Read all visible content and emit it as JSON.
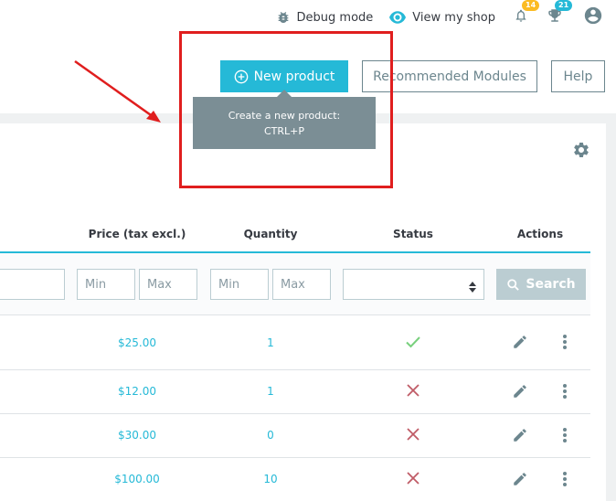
{
  "topbar": {
    "debug_label": "Debug mode",
    "view_shop_label": "View my shop",
    "orders_badge": "14",
    "customers_badge": "21",
    "orders_badge_color": "#fbbb22",
    "customers_badge_color": "#25b9d7"
  },
  "header": {
    "new_product_label": "New product",
    "recommended_label": "Recommended Modules",
    "help_label": "Help",
    "tooltip_line1": "Create a new product:",
    "tooltip_line2": "CTRL+P"
  },
  "table": {
    "columns": [
      "Price (tax excl.)",
      "Quantity",
      "Status",
      "Actions"
    ],
    "filters": {
      "price_min_placeholder": "Min",
      "price_max_placeholder": "Max",
      "qty_min_placeholder": "Min",
      "qty_max_placeholder": "Max",
      "search_label": "Search"
    },
    "rows": [
      {
        "price": "$25.00",
        "quantity": "1",
        "status": "enabled"
      },
      {
        "price": "$12.00",
        "quantity": "1",
        "status": "disabled"
      },
      {
        "price": "$30.00",
        "quantity": "0",
        "status": "disabled"
      },
      {
        "price": "$100.00",
        "quantity": "10",
        "status": "disabled"
      }
    ]
  },
  "colors": {
    "primary": "#25b9d7",
    "enabled": "#78d07d",
    "disabled": "#c05c67",
    "highlight": "#e01e1e"
  }
}
